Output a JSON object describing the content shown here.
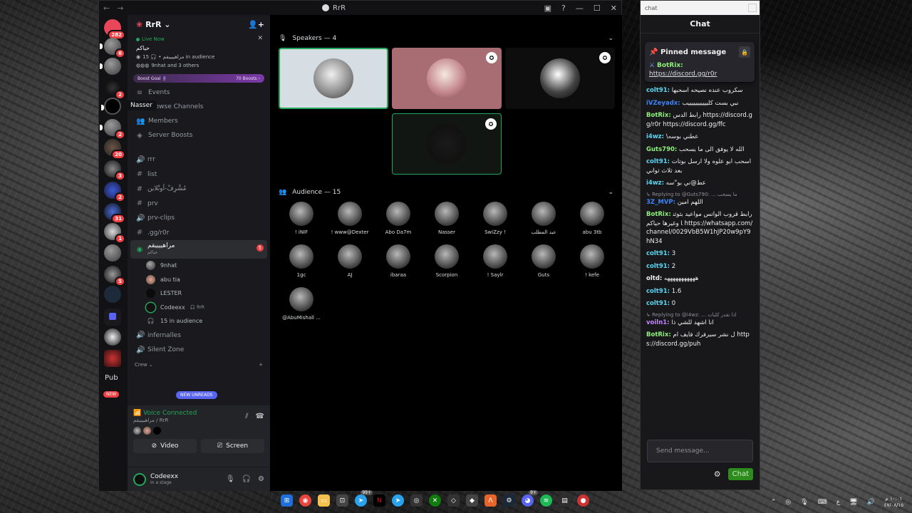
{
  "discord": {
    "title": "RrR",
    "server_name": "RrR",
    "tooltip": "Nasser",
    "guild_badges": [
      "282",
      "6",
      "",
      "2",
      "",
      "2",
      "20",
      "3",
      "2",
      "31",
      "1",
      "",
      "5",
      "",
      "",
      "",
      "",
      "",
      "NEW"
    ],
    "guild_pub": "Pub",
    "live": {
      "status": "Live Now",
      "title": "حياكم",
      "meta": "مراهييييقم • 🎧 15 in audience",
      "people": "9nhat and 3 others"
    },
    "boost": {
      "label": "Boost Goal 🪻",
      "count": "70 Boosts ›"
    },
    "nav": [
      {
        "icon": "≡",
        "label": "Events"
      },
      {
        "icon": "⌕",
        "label": "Browse Channels"
      },
      {
        "icon": "👥",
        "label": "Members"
      },
      {
        "icon": "◈",
        "label": "Server Boosts"
      }
    ],
    "channels": [
      {
        "icon": "🔊",
        "label": "rrr"
      },
      {
        "icon": "#",
        "label": "list"
      },
      {
        "icon": "#",
        "label": "مُشْرِفْ-أونْلاين"
      },
      {
        "icon": "#",
        "label": "prv"
      },
      {
        "icon": "🔊",
        "label": "prv-clips"
      },
      {
        "icon": "#",
        "label": ".gg/r0r"
      }
    ],
    "active_channel": {
      "label": "مراهييييقم",
      "sub": "حياكم",
      "badge": "5"
    },
    "voice_users": [
      {
        "name": "9nhat",
        "extra": ""
      },
      {
        "name": "abu tia",
        "extra": ""
      },
      {
        "name": "LESTER",
        "extra": ""
      },
      {
        "name": "Codeexx",
        "extra": "🎧 RrR"
      }
    ],
    "audience_count": "15 in audience",
    "channels_after": [
      {
        "icon": "🔊",
        "label": "infernalles"
      },
      {
        "icon": "🔊",
        "label": "Silent Zone"
      }
    ],
    "category": "Crew",
    "new_unreads": "NEW UNREADS",
    "voice_connected": {
      "title": "Voice Connected",
      "sub": "مراهييييقم / RrR"
    },
    "buttons": {
      "video": "Video",
      "screen": "Screen"
    },
    "user": {
      "name": "Codeexx",
      "status": "In a stage"
    }
  },
  "stage": {
    "speakers_label": "Speakers — 4",
    "audience_label": "Audience — 15",
    "audience": [
      "! iNIF",
      "! www@Dexter",
      "Abo Da7m",
      "Nasser",
      "SwiZzy !",
      "عبد المطلب",
      "abu 3tb",
      "1gc",
      "AJ",
      "ibaraa",
      "Scorpion",
      "! Saylr",
      "Guts",
      "! kefe",
      "@AbuMishall ..."
    ]
  },
  "chat": {
    "window_title": "chat",
    "header": "Chat",
    "pinned_title": "Pinned message",
    "pinned_user": "BotRix:",
    "pinned_link": "https://discord.gg/r0r",
    "messages": [
      {
        "user": "colt91:",
        "color": "#5cd6f0",
        "text": "سكروب عنده نصيحه اسحبها"
      },
      {
        "user": "iVZeyadx:",
        "color": "#3b82f6",
        "text": "نبي بست كليييييييييييب"
      },
      {
        "user": "BotRix:",
        "color": "#8ef07b",
        "text": "رابط الدس https://discord.gg/r0r https://discord.gg/ffc"
      },
      {
        "user": "i4wz:",
        "color": "#5cd6f0",
        "text": "\\عطني بوسه"
      },
      {
        "user": "Guts790:",
        "color": "#8ef07b",
        "text": "الله لا يوفق الى ما يسحب"
      },
      {
        "user": "colt91:",
        "color": "#5cd6f0",
        "text": "اسحب ابو علوه ولا ارسل بوتات بعد ثلاث ثواني"
      },
      {
        "user": "i4wz:",
        "color": "#5cd6f0",
        "text": "عط@ني بو\"سه"
      },
      {
        "user": "3Z_MVP:",
        "color": "#3b82f6",
        "text": "اللهم امين",
        "reply": "↳ Replying to @Guts790: ... ما يسحب"
      },
      {
        "user": "BotRix:",
        "color": "#8ef07b",
        "text": "رابط قروب الواتس مواعيد بثوثنا وغيرها حياكم https://whatsapp.com/channel/0029VbB5W1hJP20w9pY9hN34"
      },
      {
        "user": "colt91:",
        "color": "#5cd6f0",
        "text": "3"
      },
      {
        "user": "colt91:",
        "color": "#5cd6f0",
        "text": "2"
      },
      {
        "user": "oltd:",
        "color": "#efeff1",
        "text": "هههههههههههه"
      },
      {
        "user": "colt91:",
        "color": "#5cd6f0",
        "text": "1.6"
      },
      {
        "user": "colt91:",
        "color": "#5cd6f0",
        "text": "0"
      },
      {
        "user": "voiln1:",
        "color": "#c084fc",
        "text": "انا اشهد للشي ذا",
        "reply": "↳ Replying to @i4wz: ... اذا تقدر كلبات"
      },
      {
        "user": "BotRix:",
        "color": "#8ef07b",
        "text": "ل نشر سيرفرك فايف ام https://discord.gg/puh"
      }
    ],
    "input_placeholder": "Send message...",
    "chat_button": "Chat"
  },
  "taskbar": {
    "badges": [
      "99+",
      "9+"
    ],
    "lang": "ع",
    "time": "١٠:٠١ م",
    "date": "٤٧/٠٨/١٥"
  }
}
